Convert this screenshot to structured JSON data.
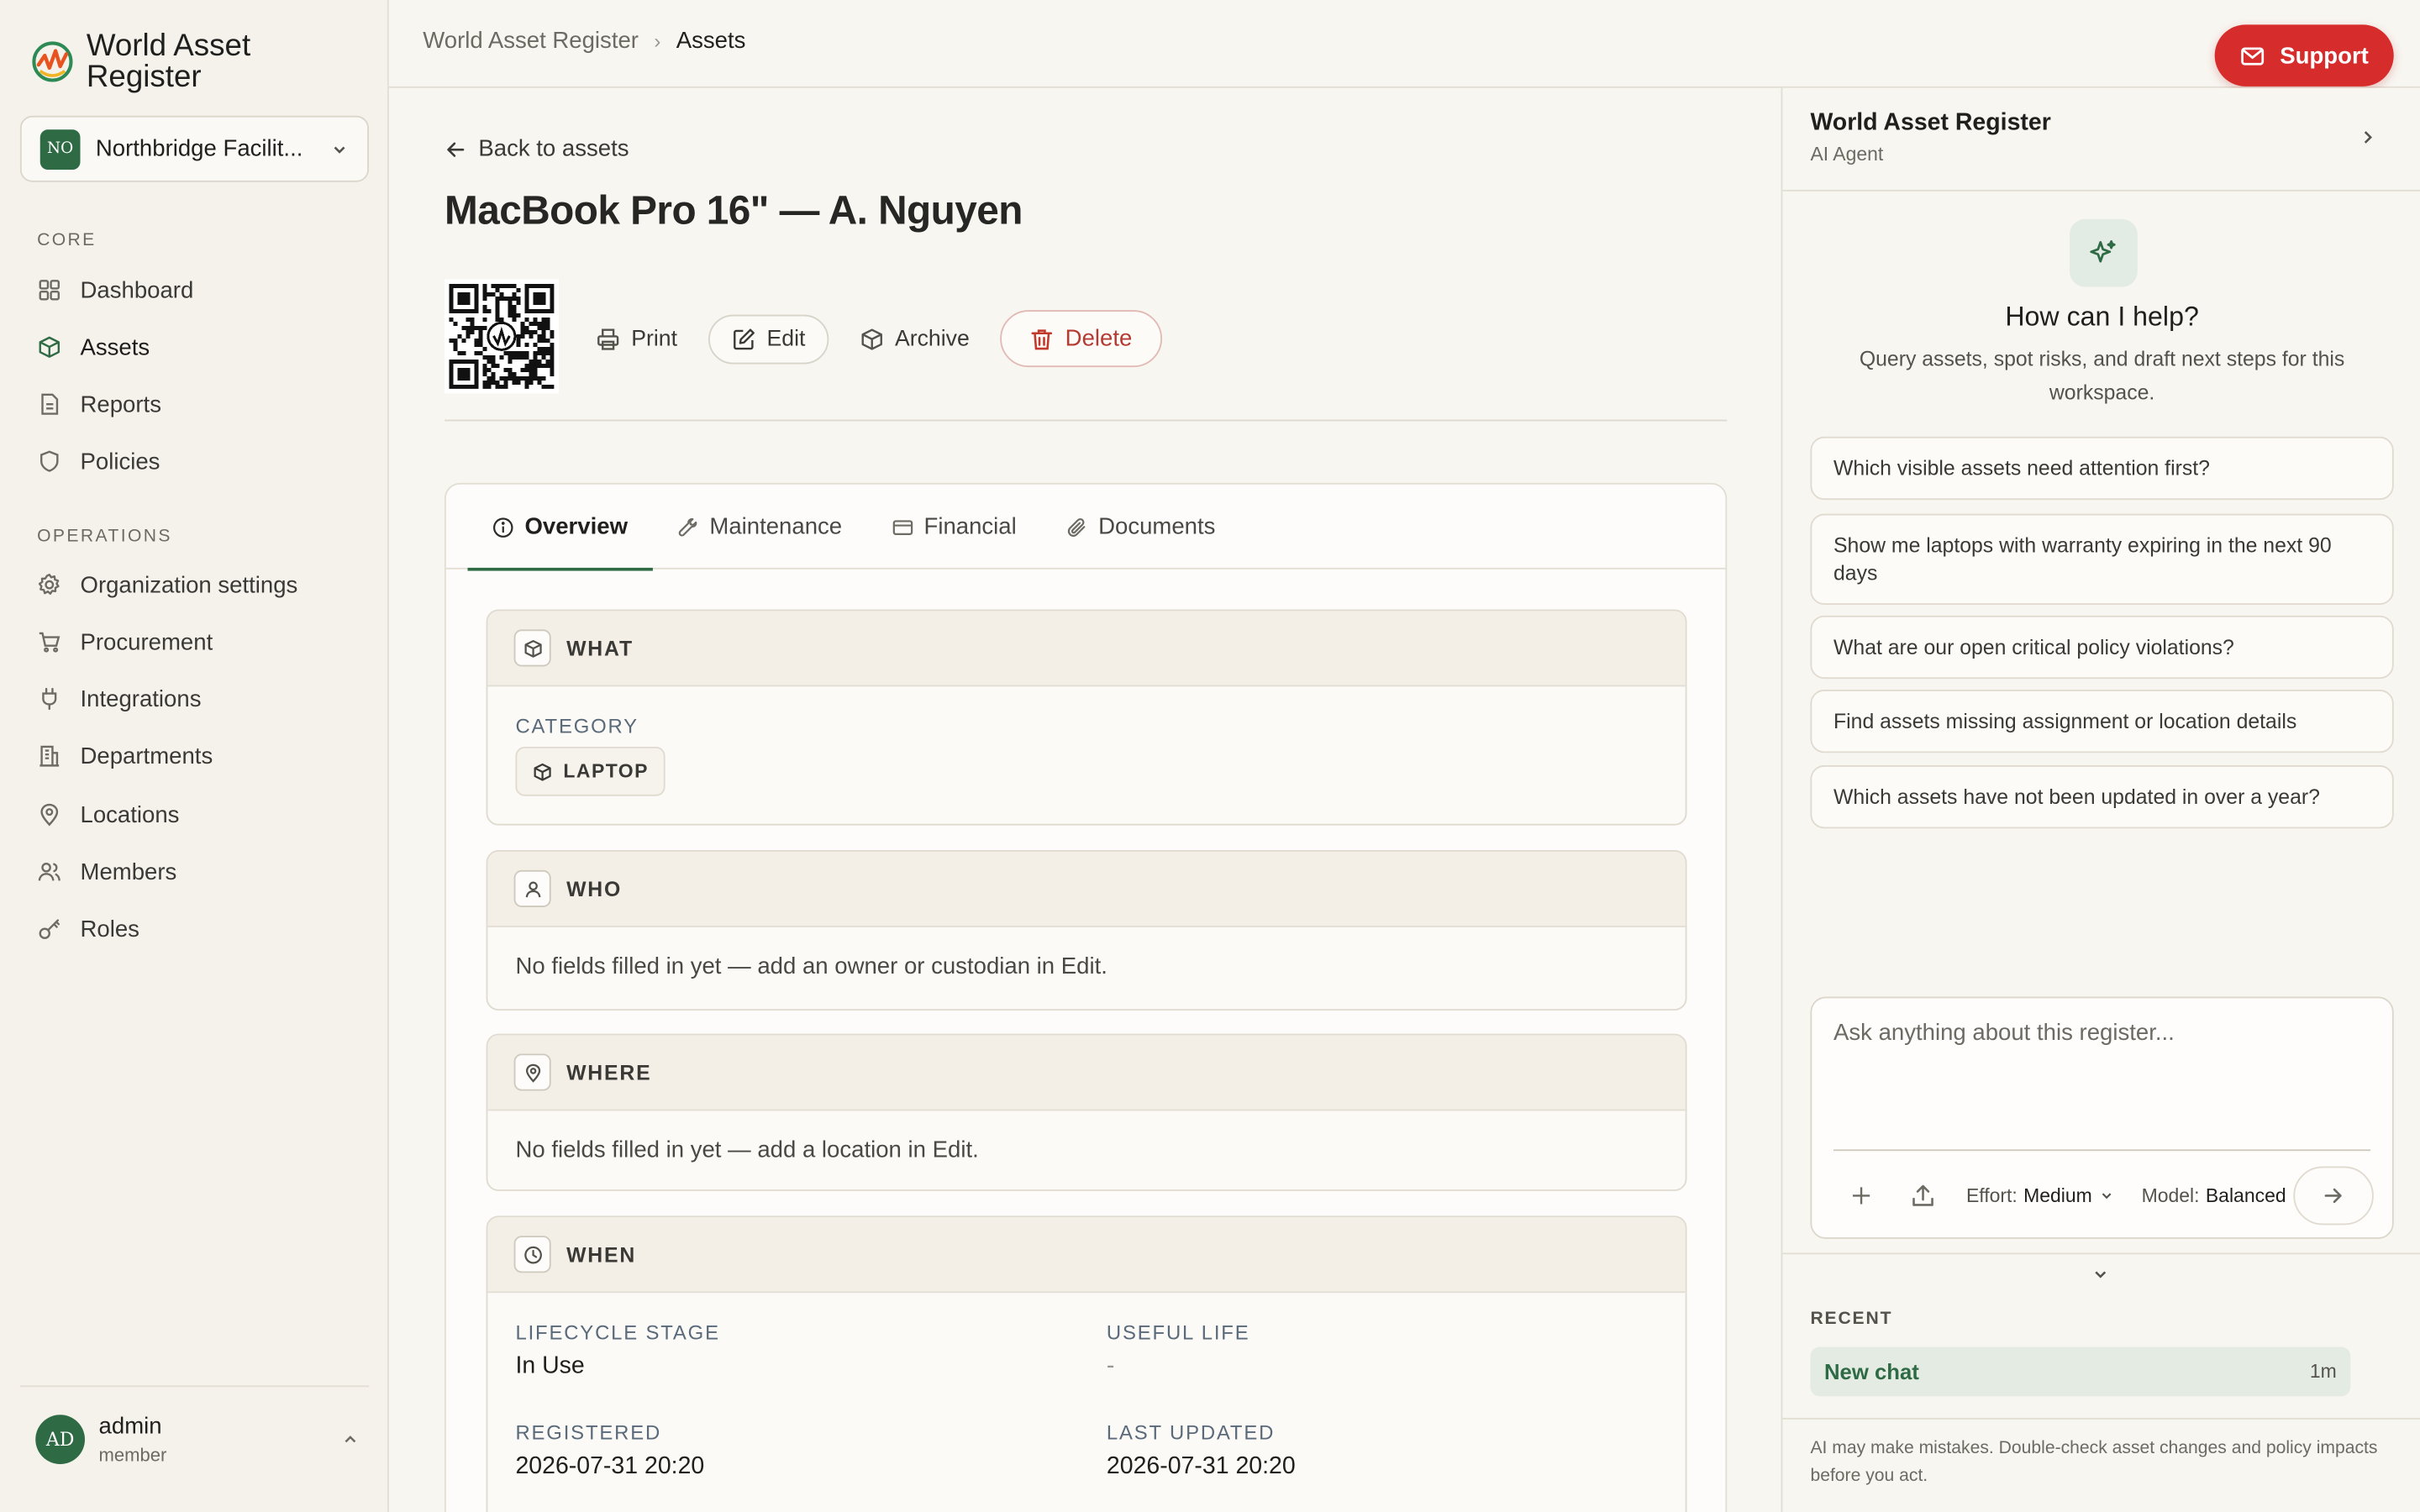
{
  "app": {
    "name": "World Asset Register",
    "org": {
      "initials": "NO",
      "name": "Northbridge Facilit..."
    }
  },
  "sidebar": {
    "core_label": "CORE",
    "core_items": [
      {
        "label": "Dashboard",
        "icon": "dashboard-icon"
      },
      {
        "label": "Assets",
        "icon": "box-icon",
        "active": true
      },
      {
        "label": "Reports",
        "icon": "report-icon"
      },
      {
        "label": "Policies",
        "icon": "shield-icon"
      }
    ],
    "ops_label": "OPERATIONS",
    "ops_items": [
      {
        "label": "Organization settings",
        "icon": "gear-icon"
      },
      {
        "label": "Procurement",
        "icon": "cart-icon"
      },
      {
        "label": "Integrations",
        "icon": "plug-icon"
      },
      {
        "label": "Departments",
        "icon": "building-icon"
      },
      {
        "label": "Locations",
        "icon": "pin-icon"
      },
      {
        "label": "Members",
        "icon": "users-icon"
      },
      {
        "label": "Roles",
        "icon": "key-icon"
      }
    ],
    "user": {
      "initials": "AD",
      "name": "admin",
      "role": "member"
    }
  },
  "topbar": {
    "breadcrumb": [
      "World Asset Register",
      "Assets"
    ],
    "support_label": "Support"
  },
  "asset": {
    "back_label": "Back to assets",
    "title": "MacBook Pro 16\" — A. Nguyen",
    "actions": {
      "print": "Print",
      "edit": "Edit",
      "archive": "Archive",
      "delete": "Delete"
    },
    "tabs": [
      "Overview",
      "Maintenance",
      "Financial",
      "Documents"
    ],
    "active_tab": "Overview",
    "what": {
      "title": "WHAT",
      "category_label": "CATEGORY",
      "category_value": "LAPTOP"
    },
    "who": {
      "title": "WHO",
      "empty": "No fields filled in yet — add an owner or custodian in Edit."
    },
    "where": {
      "title": "WHERE",
      "empty": "No fields filled in yet — add a location in Edit."
    },
    "when": {
      "title": "WHEN",
      "lifecycle_label": "LIFECYCLE STAGE",
      "lifecycle_value": "In Use",
      "useful_life_label": "USEFUL LIFE",
      "useful_life_value": "-",
      "registered_label": "REGISTERED",
      "registered_value": "2026-07-31 20:20",
      "updated_label": "LAST UPDATED",
      "updated_value": "2026-07-31 20:20"
    }
  },
  "agent": {
    "title": "World Asset Register",
    "subtitle": "AI Agent",
    "help_title": "How can I help?",
    "help_sub": "Query assets, spot risks, and draft next steps for this workspace.",
    "suggestions": [
      "Which visible assets need attention first?",
      "Show me laptops with warranty expiring in the next 90 days",
      "What are our open critical policy violations?",
      "Find assets missing assignment or location details",
      "Which assets have not been updated in over a year?"
    ],
    "composer": {
      "placeholder": "Ask anything about this register...",
      "effort_label": "Effort:",
      "effort_value": "Medium",
      "model_label": "Model:",
      "model_value": "Balanced"
    },
    "recent_label": "RECENT",
    "recent": [
      {
        "name": "New chat",
        "time": "1m"
      }
    ],
    "disclaimer": "AI may make mistakes. Double-check asset changes and policy impacts before you act."
  }
}
